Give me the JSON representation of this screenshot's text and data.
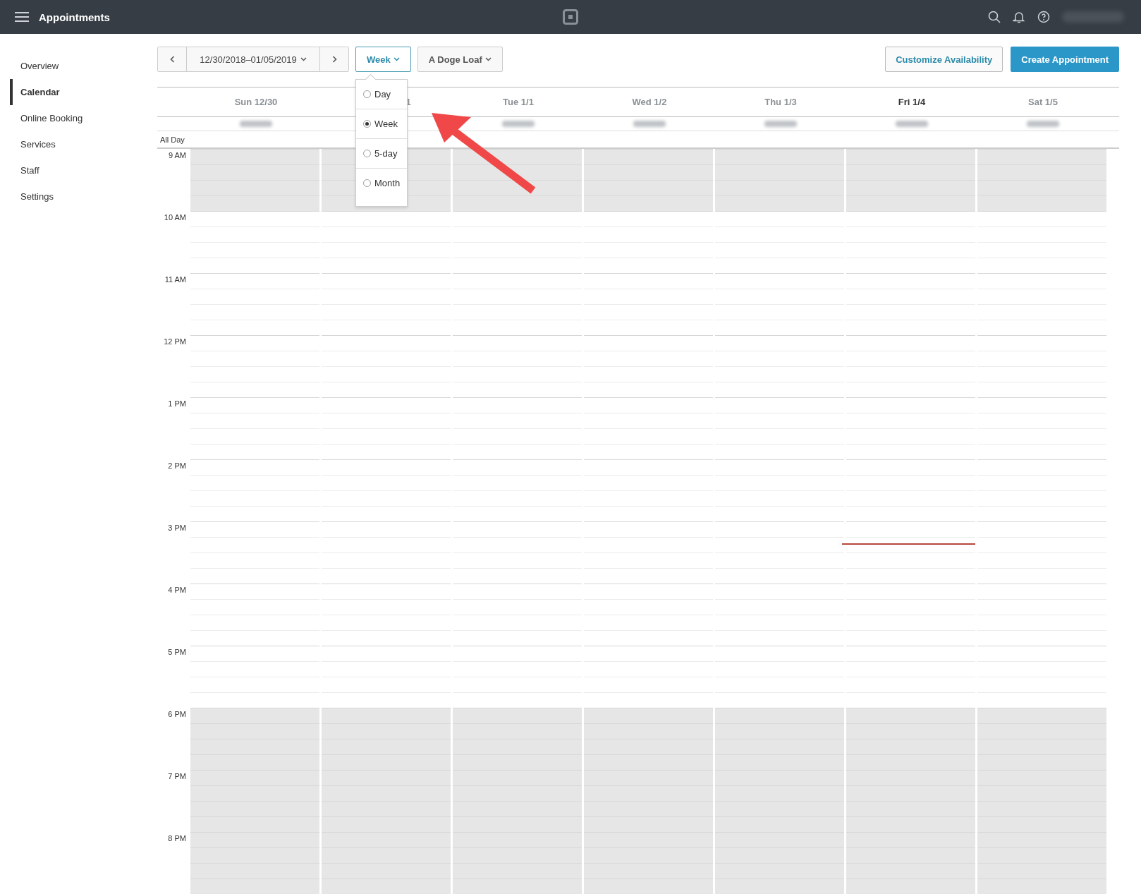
{
  "top_bar": {
    "title": "Appointments"
  },
  "sidebar": {
    "items": [
      {
        "label": "Overview",
        "selected": false
      },
      {
        "label": "Calendar",
        "selected": true
      },
      {
        "label": "Online Booking",
        "selected": false
      },
      {
        "label": "Services",
        "selected": false
      },
      {
        "label": "Staff",
        "selected": false
      },
      {
        "label": "Settings",
        "selected": false
      }
    ]
  },
  "toolbar": {
    "date_range": "12/30/2018–01/05/2019",
    "view": "Week",
    "location": "A Doge Loaf",
    "buttons": [
      {
        "label": "Customize Availability",
        "kind": "secondary"
      },
      {
        "label": "Create Appointment",
        "kind": "primary"
      }
    ]
  },
  "view_menu": {
    "open": true,
    "options": [
      {
        "label": "Day",
        "selected": false
      },
      {
        "label": "Week",
        "selected": true
      },
      {
        "label": "5-day",
        "selected": false
      },
      {
        "label": "Month",
        "selected": false
      }
    ]
  },
  "calendar": {
    "all_day_label": "All Day",
    "days": [
      {
        "label": "Sun 12/30",
        "today": false
      },
      {
        "label": "1",
        "today": false,
        "kind": "partly_covered"
      },
      {
        "label": "Tue 1/1",
        "today": false
      },
      {
        "label": "Wed 1/2",
        "today": false
      },
      {
        "label": "Thu 1/3",
        "today": false
      },
      {
        "label": "Fri 1/4",
        "today": true
      },
      {
        "label": "Sat 1/5",
        "today": false
      }
    ],
    "hours": [
      {
        "label": "9 AM",
        "closed": true,
        "now": false
      },
      {
        "label": "10 AM",
        "closed": false,
        "now": false
      },
      {
        "label": "11 AM",
        "closed": false,
        "now": false
      },
      {
        "label": "12 PM",
        "closed": false,
        "now": false
      },
      {
        "label": "1 PM",
        "closed": false,
        "now": false
      },
      {
        "label": "2 PM",
        "closed": false,
        "now": false
      },
      {
        "label": "3 PM",
        "closed": false,
        "now": true
      },
      {
        "label": "4 PM",
        "closed": false,
        "now": false
      },
      {
        "label": "5 PM",
        "closed": false,
        "now": false
      },
      {
        "label": "6 PM",
        "closed": true,
        "now": false
      },
      {
        "label": "7 PM",
        "closed": true,
        "now": false
      },
      {
        "label": "8 PM",
        "closed": true,
        "now": false
      }
    ]
  }
}
